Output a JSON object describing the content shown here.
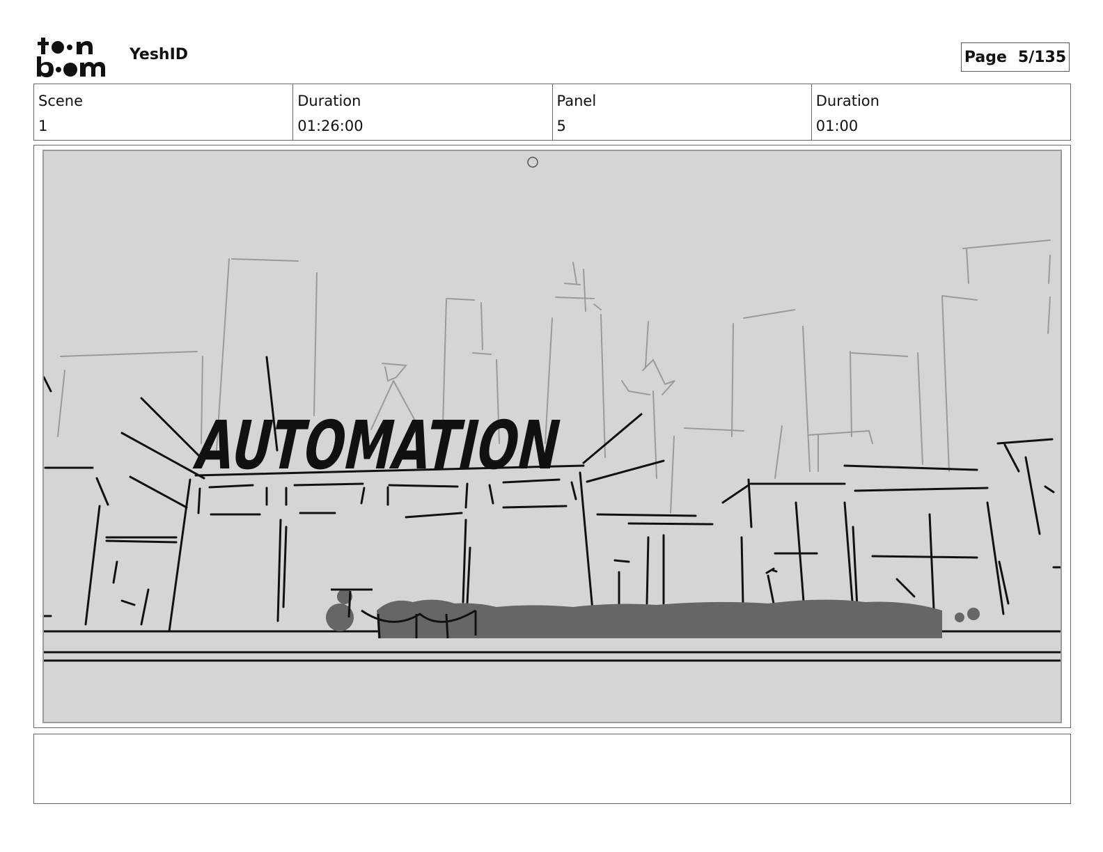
{
  "header": {
    "logo_text": "toon boom",
    "project_name": "YeshID",
    "page_label": "Page",
    "page_value": "5/135"
  },
  "info": {
    "scene_label": "Scene",
    "scene_value": "1",
    "scene_duration_label": "Duration",
    "scene_duration_value": "01:26:00",
    "panel_label": "Panel",
    "panel_value": "5",
    "panel_duration_label": "Duration",
    "panel_duration_value": "01:00"
  },
  "panel_image": {
    "sign_text": "AUTOMATION",
    "background_color": "#d5d5d5"
  },
  "notes": {
    "text": ""
  }
}
